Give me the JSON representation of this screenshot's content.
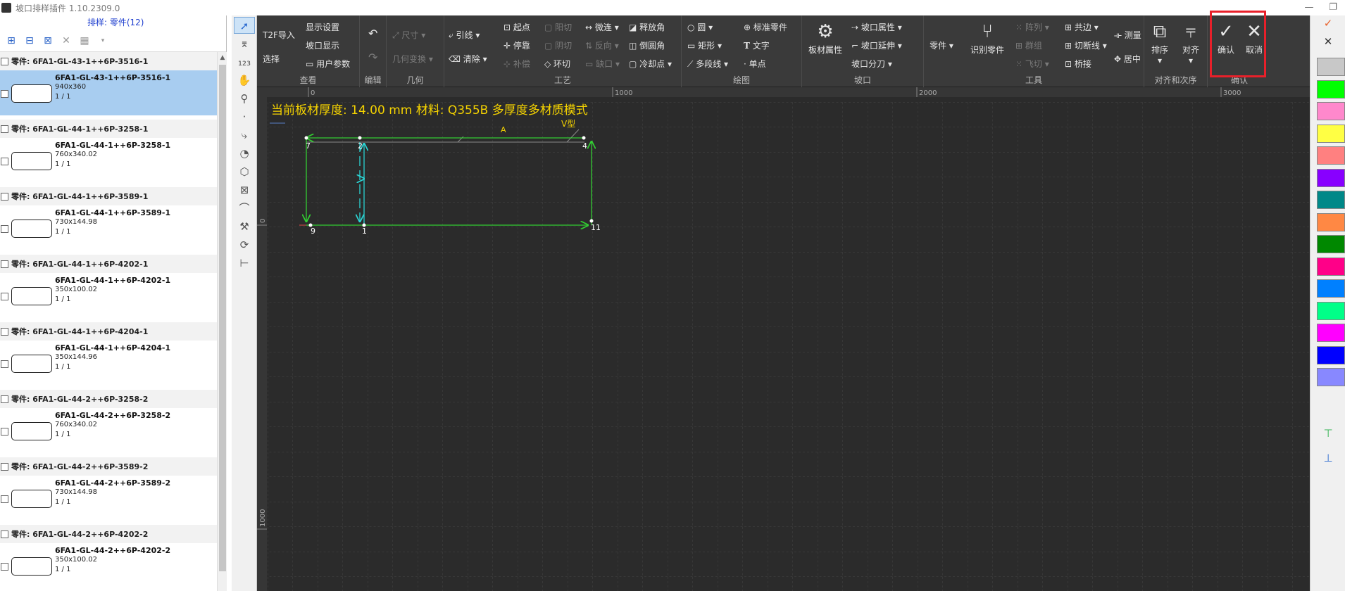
{
  "window": {
    "title": "坡口排样插件 1.10.2309.0"
  },
  "left_panel": {
    "sort_label": "排样: 零件(12)",
    "groups": [
      {
        "header": "零件: 6FA1-GL-43-1++6P-3516-1",
        "item": {
          "name": "6FA1-GL-43-1++6P-3516-1",
          "size": "940x360",
          "count": "1 / 1",
          "selected": true
        }
      },
      {
        "header": "零件: 6FA1-GL-44-1++6P-3258-1",
        "item": {
          "name": "6FA1-GL-44-1++6P-3258-1",
          "size": "760x340.02",
          "count": "1 / 1",
          "selected": false
        }
      },
      {
        "header": "零件: 6FA1-GL-44-1++6P-3589-1",
        "item": {
          "name": "6FA1-GL-44-1++6P-3589-1",
          "size": "730x144.98",
          "count": "1 / 1",
          "selected": false
        }
      },
      {
        "header": "零件: 6FA1-GL-44-1++6P-4202-1",
        "item": {
          "name": "6FA1-GL-44-1++6P-4202-1",
          "size": "350x100.02",
          "count": "1 / 1",
          "selected": false
        }
      },
      {
        "header": "零件: 6FA1-GL-44-1++6P-4204-1",
        "item": {
          "name": "6FA1-GL-44-1++6P-4204-1",
          "size": "350x144.96",
          "count": "1 / 1",
          "selected": false
        }
      },
      {
        "header": "零件: 6FA1-GL-44-2++6P-3258-2",
        "item": {
          "name": "6FA1-GL-44-2++6P-3258-2",
          "size": "760x340.02",
          "count": "1 / 1",
          "selected": false
        }
      },
      {
        "header": "零件: 6FA1-GL-44-2++6P-3589-2",
        "item": {
          "name": "6FA1-GL-44-2++6P-3589-2",
          "size": "730x144.98",
          "count": "1 / 1",
          "selected": false
        }
      },
      {
        "header": "零件: 6FA1-GL-44-2++6P-4202-2",
        "item": {
          "name": "6FA1-GL-44-2++6P-4202-2",
          "size": "350x100.02",
          "count": "1 / 1",
          "selected": false
        }
      }
    ]
  },
  "ribbon": {
    "groups": {
      "view": "查看",
      "edit": "编辑",
      "geometry": "几何",
      "process": "工艺",
      "draw": "绘图",
      "bevel": "坡口",
      "tools": "工具",
      "align": "对齐和次序",
      "confirm": "确认"
    },
    "view": {
      "t2f": "T2F导入",
      "select": "选择",
      "display_settings": "显示设置",
      "bevel_display": "坡口显示",
      "user_params": "用户参数"
    },
    "geometry": {
      "size": "尺寸",
      "transform": "几何变换"
    },
    "process": {
      "lead": "引线",
      "clear": "清除",
      "start": "起点",
      "stop": "停靠",
      "compensate": "补偿",
      "positive": "阳切",
      "negative": "阴切",
      "loop_cut": "环切",
      "micro": "微连",
      "reverse": "反向",
      "gap": "缺口",
      "release_angle": "释放角",
      "chamfer": "倒圆角",
      "cooling": "冷却点"
    },
    "draw": {
      "circle": "圆",
      "rect": "矩形",
      "polyline": "多段线",
      "std_part": "标准零件",
      "text": "文字",
      "point": "单点"
    },
    "bevel": {
      "plate_props": "板材属性",
      "bevel_props": "坡口属性",
      "bevel_extend": "坡口延伸",
      "bevel_split": "坡口分刀"
    },
    "tools": {
      "part": "零件",
      "recognize": "识别零件",
      "array": "阵列",
      "group": "群组",
      "fly_cut": "飞切",
      "common_edge": "共边",
      "cut_line": "切断线",
      "bridge": "桥接",
      "measure": "测量",
      "center": "居中"
    },
    "align": {
      "sort": "排序",
      "align": "对齐"
    },
    "confirm": {
      "ok": "确认",
      "cancel": "取消"
    }
  },
  "canvas": {
    "info": "当前板材厚度: 14.00 mm 材料: Q355B 多厚度多材质模式",
    "ruler_x": [
      "0",
      "1000",
      "2000",
      "3000"
    ],
    "ruler_y": [
      "0",
      "1000"
    ],
    "labels": {
      "a": "A",
      "v": "V型"
    },
    "points": [
      "7",
      "2",
      "4",
      "9",
      "1",
      "11"
    ]
  },
  "colors": {
    "accent": "#e8202a",
    "shape": "#32cd32",
    "cyan": "#2bd4d4",
    "info_text": "#f5d300",
    "swatches": [
      "#c8c8c8",
      "#00ff00",
      "#ff88cc",
      "#ffff44",
      "#ff8080",
      "#8800ff",
      "#008888",
      "#ff8844",
      "#008800",
      "#ff0088",
      "#0080ff",
      "#00ff88",
      "#ff00ff",
      "#0000ff",
      "#8888ff"
    ]
  }
}
